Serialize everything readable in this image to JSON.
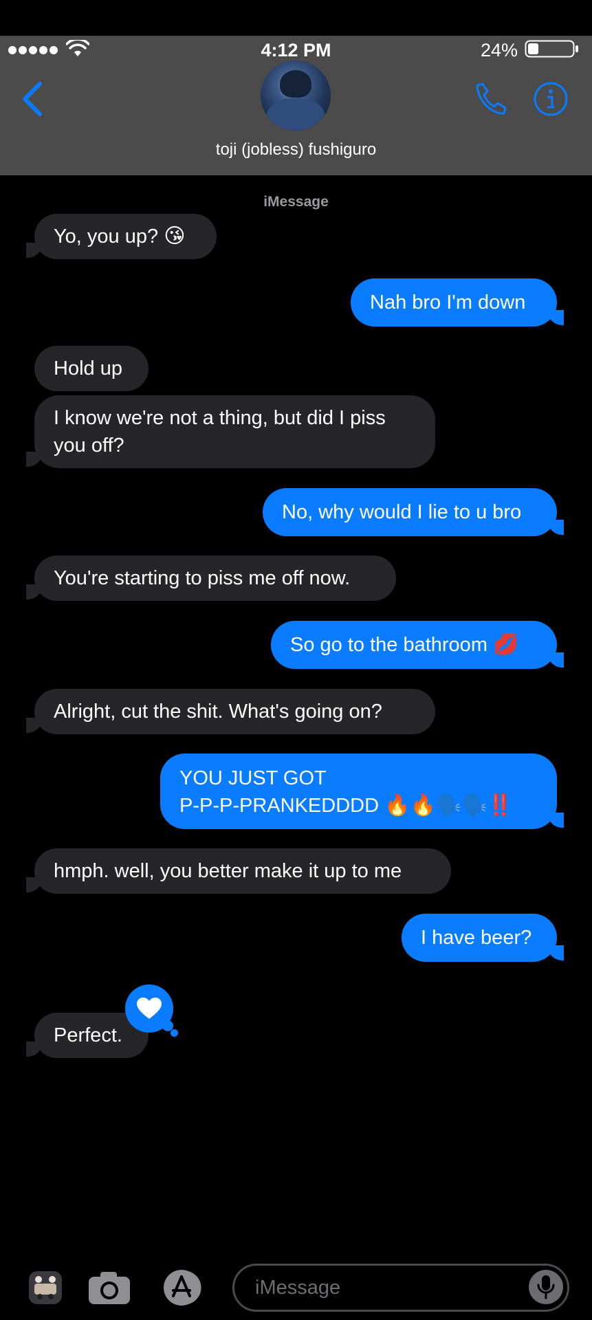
{
  "status_bar": {
    "time": "4:12 PM",
    "battery": "24%"
  },
  "header": {
    "contact_name": "toji (jobless) fushiguro"
  },
  "thread": {
    "service": "iMessage",
    "messages": [
      {
        "from": "them",
        "text": "Yo, you up?",
        "emoji": "😘"
      },
      {
        "from": "me",
        "text": "Nah bro I'm down",
        "emoji": ""
      },
      {
        "from": "them",
        "text": "Hold up",
        "emoji": ""
      },
      {
        "from": "them",
        "text": "I know we're not a thing, but did I piss\nyou off?",
        "emoji": ""
      },
      {
        "from": "me",
        "text": "No, why would I lie to u bro",
        "emoji": ""
      },
      {
        "from": "them",
        "text": "You're starting to piss me off now.",
        "emoji": ""
      },
      {
        "from": "me",
        "text": "So go to the bathroom",
        "emoji": "💋"
      },
      {
        "from": "them",
        "text": "Alright, cut the shit. What's going on?",
        "emoji": ""
      },
      {
        "from": "me",
        "text": "YOU JUST GOT\nP-P-P-PRANKEDDDD",
        "emoji": "🔥🔥🗣️🗣️‼️"
      },
      {
        "from": "them",
        "text": "hmph. well, you better make it up to me",
        "emoji": ""
      },
      {
        "from": "me",
        "text": "I have beer?",
        "emoji": ""
      },
      {
        "from": "them",
        "text": "Perfect.",
        "emoji": ""
      }
    ]
  },
  "input": {
    "placeholder": "iMessage"
  },
  "colors": {
    "accent": "#0a7cff",
    "incoming_bubble": "#26252a",
    "header_bg": "#4b4b4b"
  }
}
